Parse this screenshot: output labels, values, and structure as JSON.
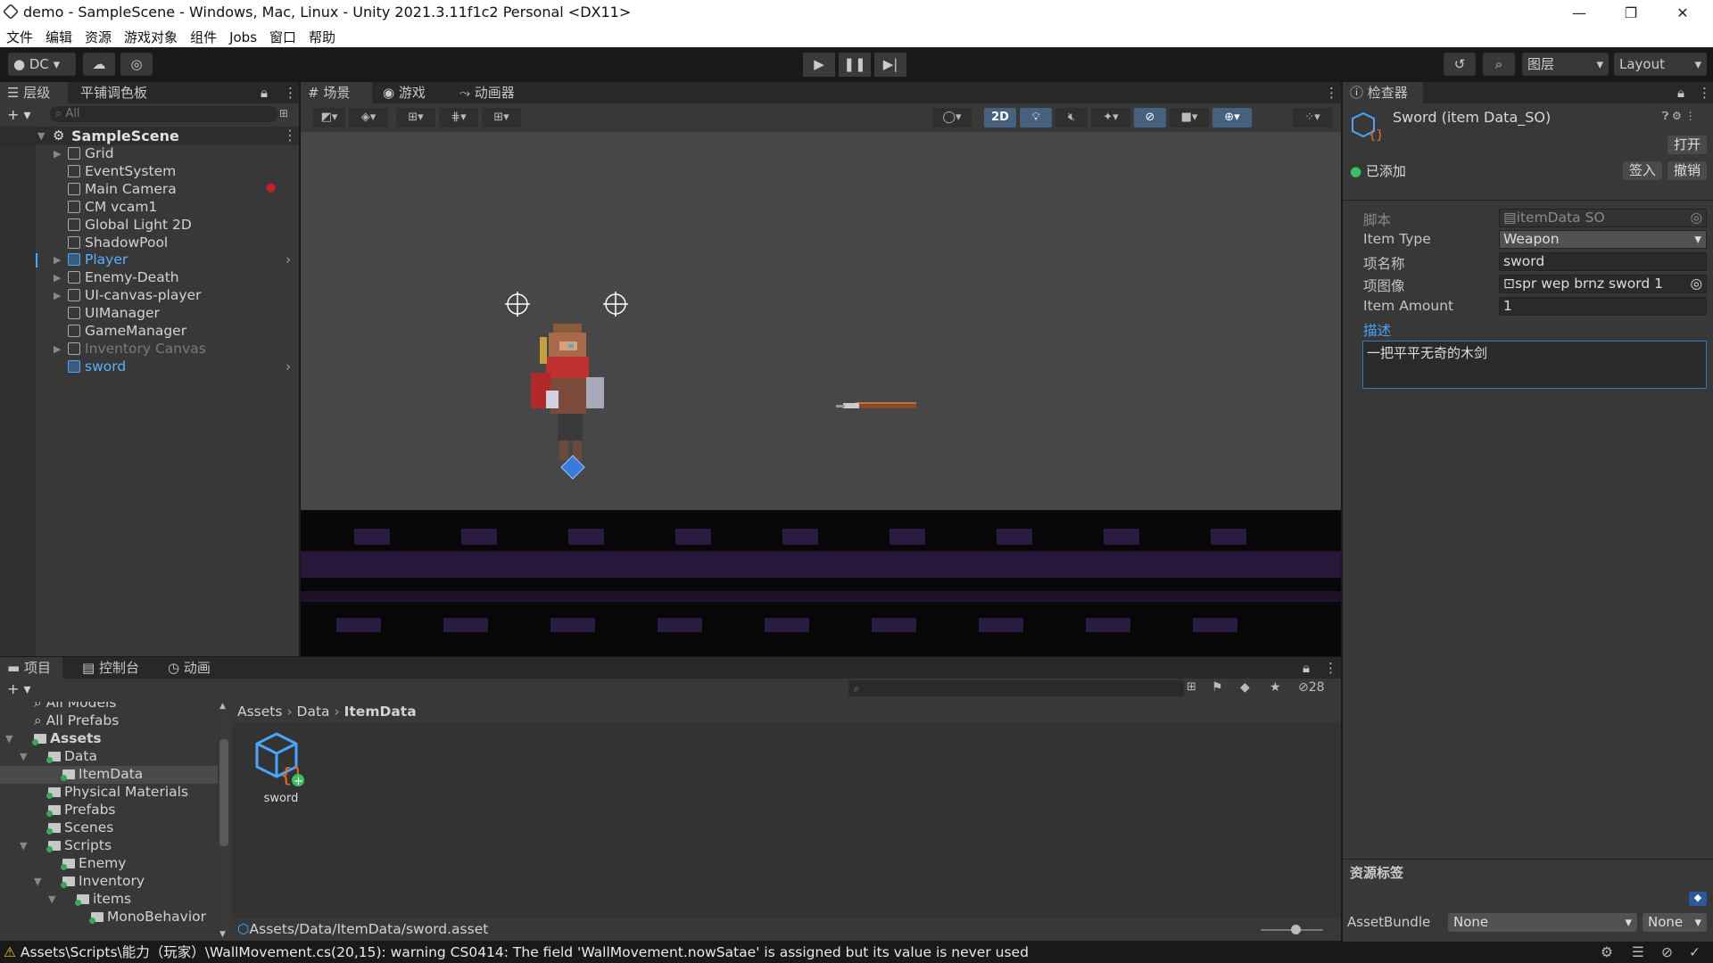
{
  "window": {
    "title": "demo - SampleScene - Windows, Mac, Linux - Unity 2021.3.11f1c2 Personal <DX11>",
    "minimize": "—",
    "maximize": "❐",
    "close": "✕"
  },
  "menu": [
    "文件",
    "编辑",
    "资源",
    "游戏对象",
    "组件",
    "Jobs",
    "窗口",
    "帮助"
  ],
  "toolbar": {
    "account": "DC",
    "layers": "图层",
    "layout": "Layout"
  },
  "hierarchy": {
    "tabs": [
      "层级",
      "平铺调色板"
    ],
    "search_placeholder": "All",
    "scene": "SampleScene",
    "items": [
      {
        "label": "Grid",
        "expandable": true,
        "style": "normal"
      },
      {
        "label": "EventSystem",
        "expandable": false,
        "style": "normal"
      },
      {
        "label": "Main Camera",
        "expandable": false,
        "style": "normal"
      },
      {
        "label": "CM vcam1",
        "expandable": false,
        "style": "normal"
      },
      {
        "label": "Global Light 2D",
        "expandable": false,
        "style": "normal"
      },
      {
        "label": "ShadowPool",
        "expandable": false,
        "style": "normal"
      },
      {
        "label": "Player",
        "expandable": true,
        "style": "prefab"
      },
      {
        "label": "Enemy-Death",
        "expandable": true,
        "style": "normal"
      },
      {
        "label": "UI-canvas-player",
        "expandable": true,
        "style": "normal"
      },
      {
        "label": "UIManager",
        "expandable": false,
        "style": "normal"
      },
      {
        "label": "GameManager",
        "expandable": false,
        "style": "normal"
      },
      {
        "label": "Inventory Canvas",
        "expandable": true,
        "style": "disabled"
      },
      {
        "label": "sword",
        "expandable": false,
        "style": "prefab"
      }
    ]
  },
  "scene_view": {
    "tabs": [
      "场景",
      "游戏",
      "动画器"
    ],
    "mode_2d": "2D"
  },
  "inspector": {
    "tab": "检查器",
    "object_title": "Sword (item Data_SO)",
    "open_button": "打开",
    "added_label": "已添加",
    "checkin_button": "签入",
    "revert_button": "撤销",
    "fields": [
      {
        "label": "脚本",
        "value": "itemData SO",
        "disabled": true
      },
      {
        "label": "Item Type",
        "value": "Weapon",
        "dropdown": true
      },
      {
        "label": "项名称",
        "value": "sword"
      },
      {
        "label": "项图像",
        "value": "spr wep brnz sword 1"
      },
      {
        "label": "Item Amount",
        "value": "1"
      }
    ],
    "desc_label": "描述",
    "desc_value": "一把平平无奇的木剑",
    "asset_labels": "资源标签",
    "assetbundle_label": "AssetBundle",
    "assetbundle_value": "None",
    "assetbundle_variant": "None"
  },
  "project": {
    "tabs": [
      "项目",
      "控制台",
      "动画"
    ],
    "hidden_count": "28",
    "tree_partial_top": "All Models",
    "tree": [
      {
        "label": "All Prefabs",
        "indent": 0,
        "type": "search"
      },
      {
        "label": "Assets",
        "indent": 0,
        "type": "folder",
        "bold": true,
        "open": true
      },
      {
        "label": "Data",
        "indent": 1,
        "type": "folder",
        "open": true
      },
      {
        "label": "ItemData",
        "indent": 2,
        "type": "folder",
        "selected": true
      },
      {
        "label": "Physical Materials",
        "indent": 1,
        "type": "folder"
      },
      {
        "label": "Prefabs",
        "indent": 1,
        "type": "folder"
      },
      {
        "label": "Scenes",
        "indent": 1,
        "type": "folder"
      },
      {
        "label": "Scripts",
        "indent": 1,
        "type": "folder",
        "open": true
      },
      {
        "label": "Enemy",
        "indent": 2,
        "type": "folder"
      },
      {
        "label": "Inventory",
        "indent": 2,
        "type": "folder",
        "open": true
      },
      {
        "label": "items",
        "indent": 3,
        "type": "folder",
        "open": true
      },
      {
        "label": "MonoBehavior",
        "indent": 4,
        "type": "folder"
      }
    ],
    "breadcrumb": [
      "Assets",
      "Data",
      "ItemData"
    ],
    "asset_name": "sword",
    "path": "Assets/Data/ItemData/sword.asset"
  },
  "status": {
    "warning": "Assets\\Scripts\\能力（玩家）\\WallMovement.cs(20,15): warning CS0414: The field 'WallMovement.nowSatae' is assigned but its value is never used"
  }
}
